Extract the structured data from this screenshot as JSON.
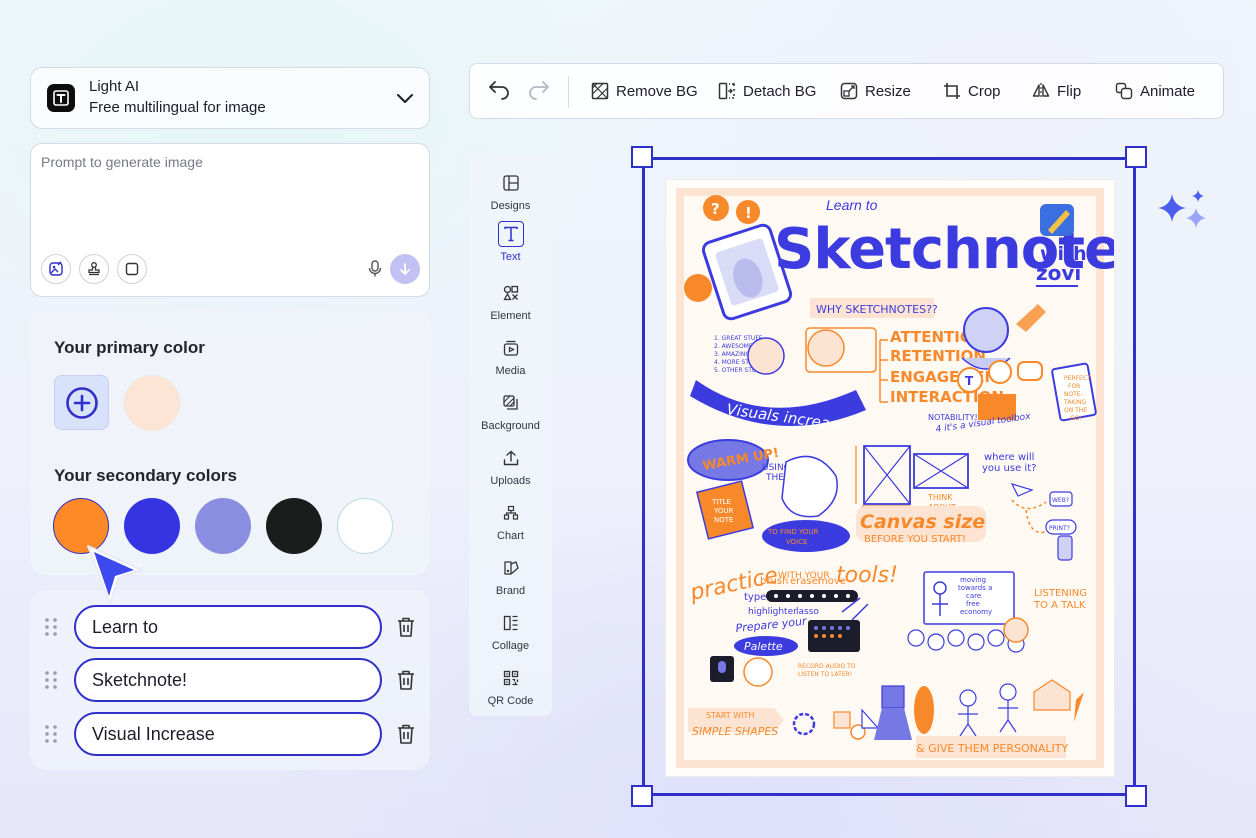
{
  "model": {
    "name": "Light AI",
    "description": "Free multilingual for image",
    "logo_letter": "T"
  },
  "prompt": {
    "placeholder": "Prompt to generate image",
    "value": ""
  },
  "colors": {
    "primary_title": "Your primary color",
    "primary_swatch": "#fde5d5",
    "secondary_title": "Your secondary colors",
    "secondary_swatches": [
      "#fd8a26",
      "#3434e3",
      "#8a8ee0",
      "#1b1d1c",
      "#ffffff"
    ]
  },
  "text_layers": [
    {
      "label": "Learn to"
    },
    {
      "label": "Sketchnote!"
    },
    {
      "label": "Visual Increase"
    }
  ],
  "toolbar": {
    "remove_bg": "Remove BG",
    "detach_bg": "Detach BG",
    "resize": "Resize",
    "crop": "Crop",
    "flip": "Flip",
    "animate": "Animate"
  },
  "sidenav": {
    "items": [
      {
        "label": "Designs",
        "icon": "layout-icon"
      },
      {
        "label": "Text",
        "icon": "text-icon",
        "active": true
      },
      {
        "label": "Element",
        "icon": "shapes-icon"
      },
      {
        "label": "Media",
        "icon": "media-icon"
      },
      {
        "label": "Background",
        "icon": "background-icon"
      },
      {
        "label": "Uploads",
        "icon": "upload-icon"
      },
      {
        "label": "Chart",
        "icon": "chart-icon"
      },
      {
        "label": "Brand",
        "icon": "brand-icon"
      },
      {
        "label": "Collage",
        "icon": "collage-icon"
      },
      {
        "label": "QR Code",
        "icon": "qr-code-icon"
      }
    ]
  },
  "canvas": {
    "small_title": "Learn to",
    "big_title": "Sketchnote!",
    "with": "with",
    "brand": "zovi",
    "why": "WHY SKETCHNOTES??",
    "list": [
      "ATTENTION",
      "RETENTION",
      "ENGAGEMENT",
      "INTERACTION"
    ],
    "banner": "Visuals increase",
    "great_list": [
      "1. GREAT STUFF",
      "2. AWESOME STUFF",
      "3. AMAZING STUFF",
      "4. MORE STUFF",
      "5. OTHER STUFF"
    ],
    "notability": "NOTABILITY!",
    "visual_toolbox": "4 it's a visual toolbox",
    "perfect": [
      "PERFECT",
      "FOR",
      "NOTE-",
      "TAKING",
      "ON THE",
      "GO!"
    ],
    "warm_up": "WARM UP!",
    "using_the": [
      "USING",
      "THE"
    ],
    "title_your_note": [
      "TITLE",
      "YOUR",
      "NOTE"
    ],
    "to_find": [
      "TO FIND YOUR",
      "VOICE"
    ],
    "think_about": [
      "THINK",
      "ABOUT"
    ],
    "canvas_size": "Canvas size",
    "before": "BEFORE YOU START!",
    "where_will": [
      "where will",
      "you use it?"
    ],
    "web": "WEB?",
    "print": "PRINT?",
    "practice": "practice",
    "with_your": "WITH YOUR",
    "tools": "tools!",
    "brush": "brush",
    "eraser": "eraser",
    "move": "move",
    "type": "type",
    "highlighter": "highlighter",
    "lasso": "lasso",
    "prepare": "Prepare your",
    "palette": "Palette",
    "moving": [
      "moving",
      "towards a",
      "care",
      "free",
      "economy"
    ],
    "listening": [
      "LISTENING",
      "TO A TALK"
    ],
    "record": [
      "RECORD AUDIO TO",
      "LISTEN TO LATER!"
    ],
    "start_with": "START WITH",
    "simple_shapes": "SIMPLE SHAPES",
    "give_them": "& GIVE THEM PERSONALITY"
  }
}
